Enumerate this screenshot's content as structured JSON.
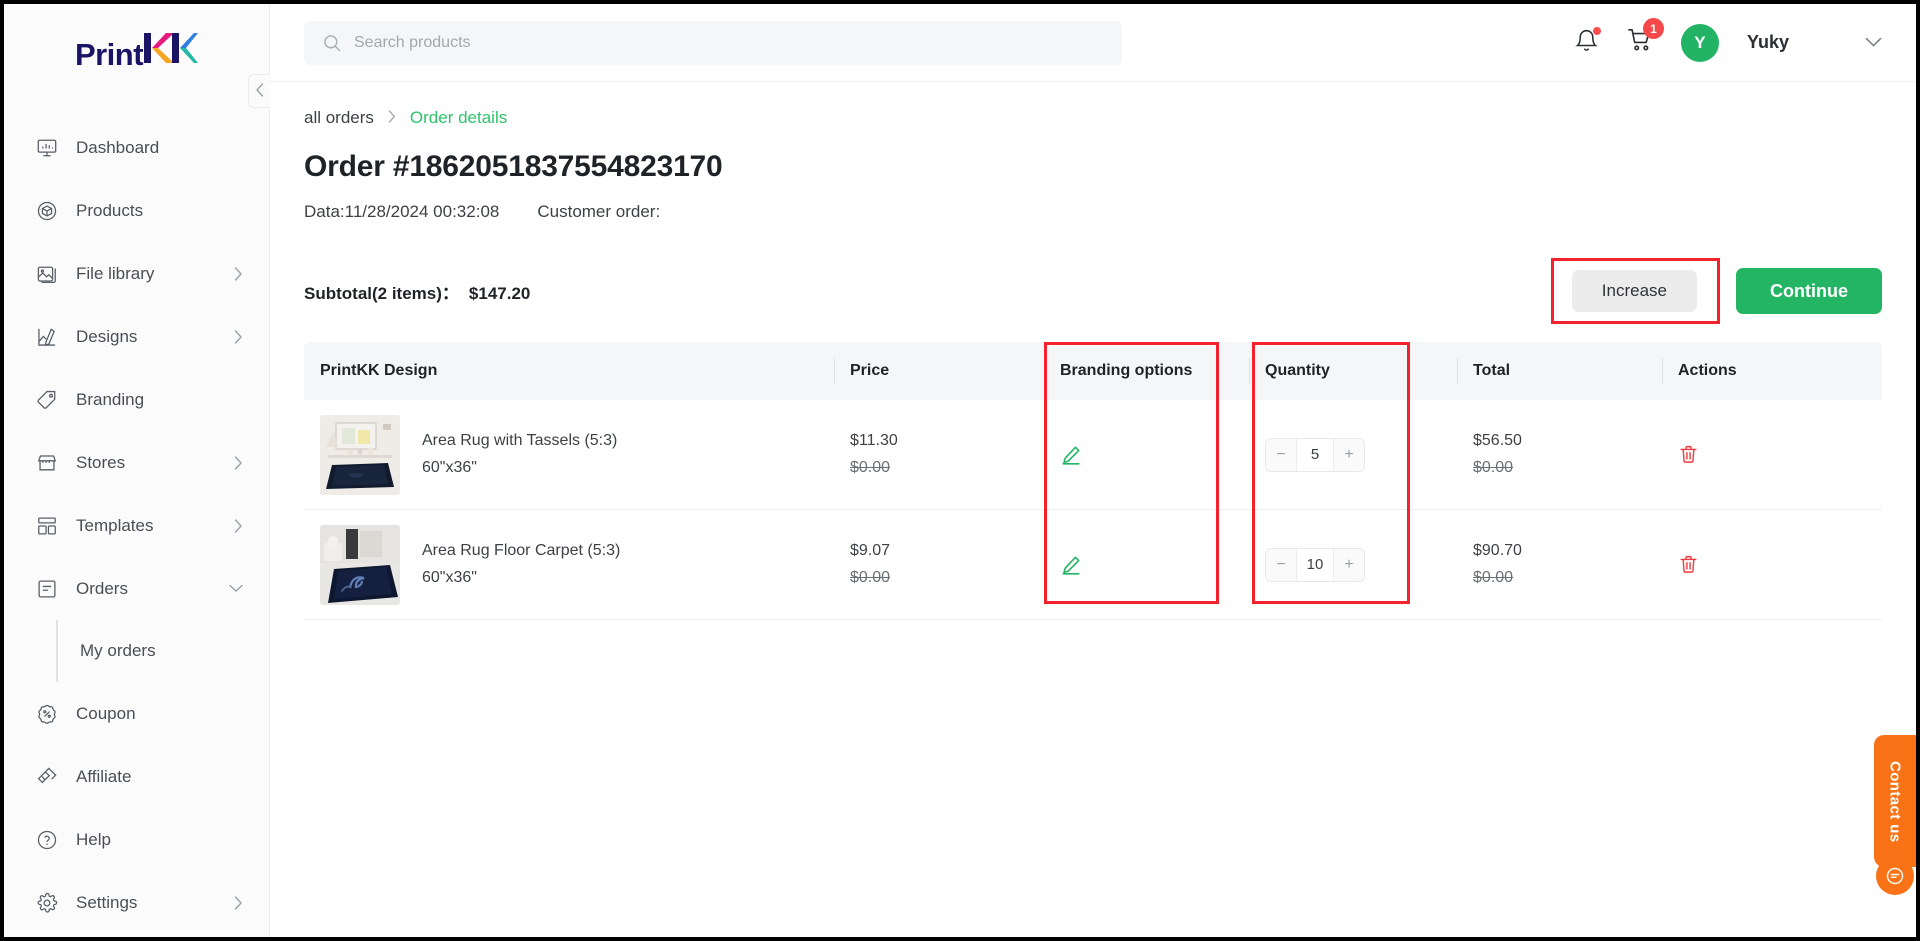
{
  "brand": {
    "name_part1": "Print",
    "name_part2": "KK",
    "color_dark": "#1b1464",
    "color_magenta": "#e6197f",
    "color_orange": "#f5a623",
    "color_blue": "#2f7fe0",
    "color_teal": "#22b8a6"
  },
  "sidebar": {
    "collapse_icon": "chevron-left-icon",
    "items": [
      {
        "label": "Dashboard",
        "icon": "dashboard-monitor-icon",
        "expandable": false
      },
      {
        "label": "Products",
        "icon": "box-cube-icon",
        "expandable": false
      },
      {
        "label": "File library",
        "icon": "image-folder-icon",
        "expandable": true
      },
      {
        "label": "Designs",
        "icon": "design-pen-icon",
        "expandable": true
      },
      {
        "label": "Branding",
        "icon": "tag-icon",
        "expandable": false
      },
      {
        "label": "Stores",
        "icon": "storefront-icon",
        "expandable": true
      },
      {
        "label": "Templates",
        "icon": "templates-grid-icon",
        "expandable": true
      },
      {
        "label": "Orders",
        "icon": "order-list-icon",
        "expandable": true,
        "expanded": true
      },
      {
        "label": "Coupon",
        "icon": "percent-badge-icon",
        "expandable": false
      },
      {
        "label": "Affiliate",
        "icon": "affiliate-link-icon",
        "expandable": false
      },
      {
        "label": "Help",
        "icon": "question-circle-icon",
        "expandable": false
      },
      {
        "label": "Settings",
        "icon": "gear-icon",
        "expandable": true
      }
    ],
    "orders_sub_items": [
      {
        "label": "My orders"
      }
    ]
  },
  "topbar": {
    "search": {
      "placeholder": "Search products",
      "value": "",
      "icon": "search-icon"
    },
    "notifications": {
      "icon": "bell-icon",
      "has_dot": true
    },
    "cart": {
      "icon": "cart-icon",
      "count": "1"
    },
    "user": {
      "avatar_initial": "Y",
      "name": "Yuky",
      "avatar_color": "#22b364",
      "chevron": "chevron-down-icon"
    }
  },
  "breadcrumb": {
    "root": "all orders",
    "separator": "›",
    "current": "Order details",
    "current_color": "#2ec46b"
  },
  "order": {
    "title": "Order #1862051837554823170",
    "date_label": "Data:11/28/2024 00:32:08",
    "customer_order_label": "Customer order:"
  },
  "summary": {
    "subtotal_label": "Subtotal(2 items)：",
    "subtotal_amount": "$147.20",
    "increase_button": "Increase",
    "continue_button": "Continue",
    "continue_color": "#23b563"
  },
  "table": {
    "columns": [
      "PrintKK Design",
      "Price",
      "Branding options",
      "Quantity",
      "Total",
      "Actions"
    ],
    "rows": [
      {
        "product_name": "Area Rug with Tassels (5:3)",
        "product_size": "60\"x36\"",
        "thumb": "area-rug-tassels-thumbnail",
        "price": "$11.30",
        "price_original": "$0.00",
        "branding_icon": "edit-pencil-icon",
        "quantity": "5",
        "total": "$56.50",
        "total_original": "$0.00",
        "action_icon": "trash-icon"
      },
      {
        "product_name": "Area Rug Floor Carpet (5:3)",
        "product_size": "60\"x36\"",
        "thumb": "area-rug-floor-carpet-thumbnail",
        "price": "$9.07",
        "price_original": "$0.00",
        "branding_icon": "edit-pencil-icon",
        "quantity": "10",
        "total": "$90.70",
        "total_original": "$0.00",
        "action_icon": "trash-icon"
      }
    ],
    "stepper": {
      "minus": "−",
      "plus": "+"
    }
  },
  "contact_widget": {
    "label": "Contact us",
    "icon": "chat-bubble-icon",
    "color": "#f97316"
  },
  "highlights": {
    "color": "#f3222d"
  }
}
